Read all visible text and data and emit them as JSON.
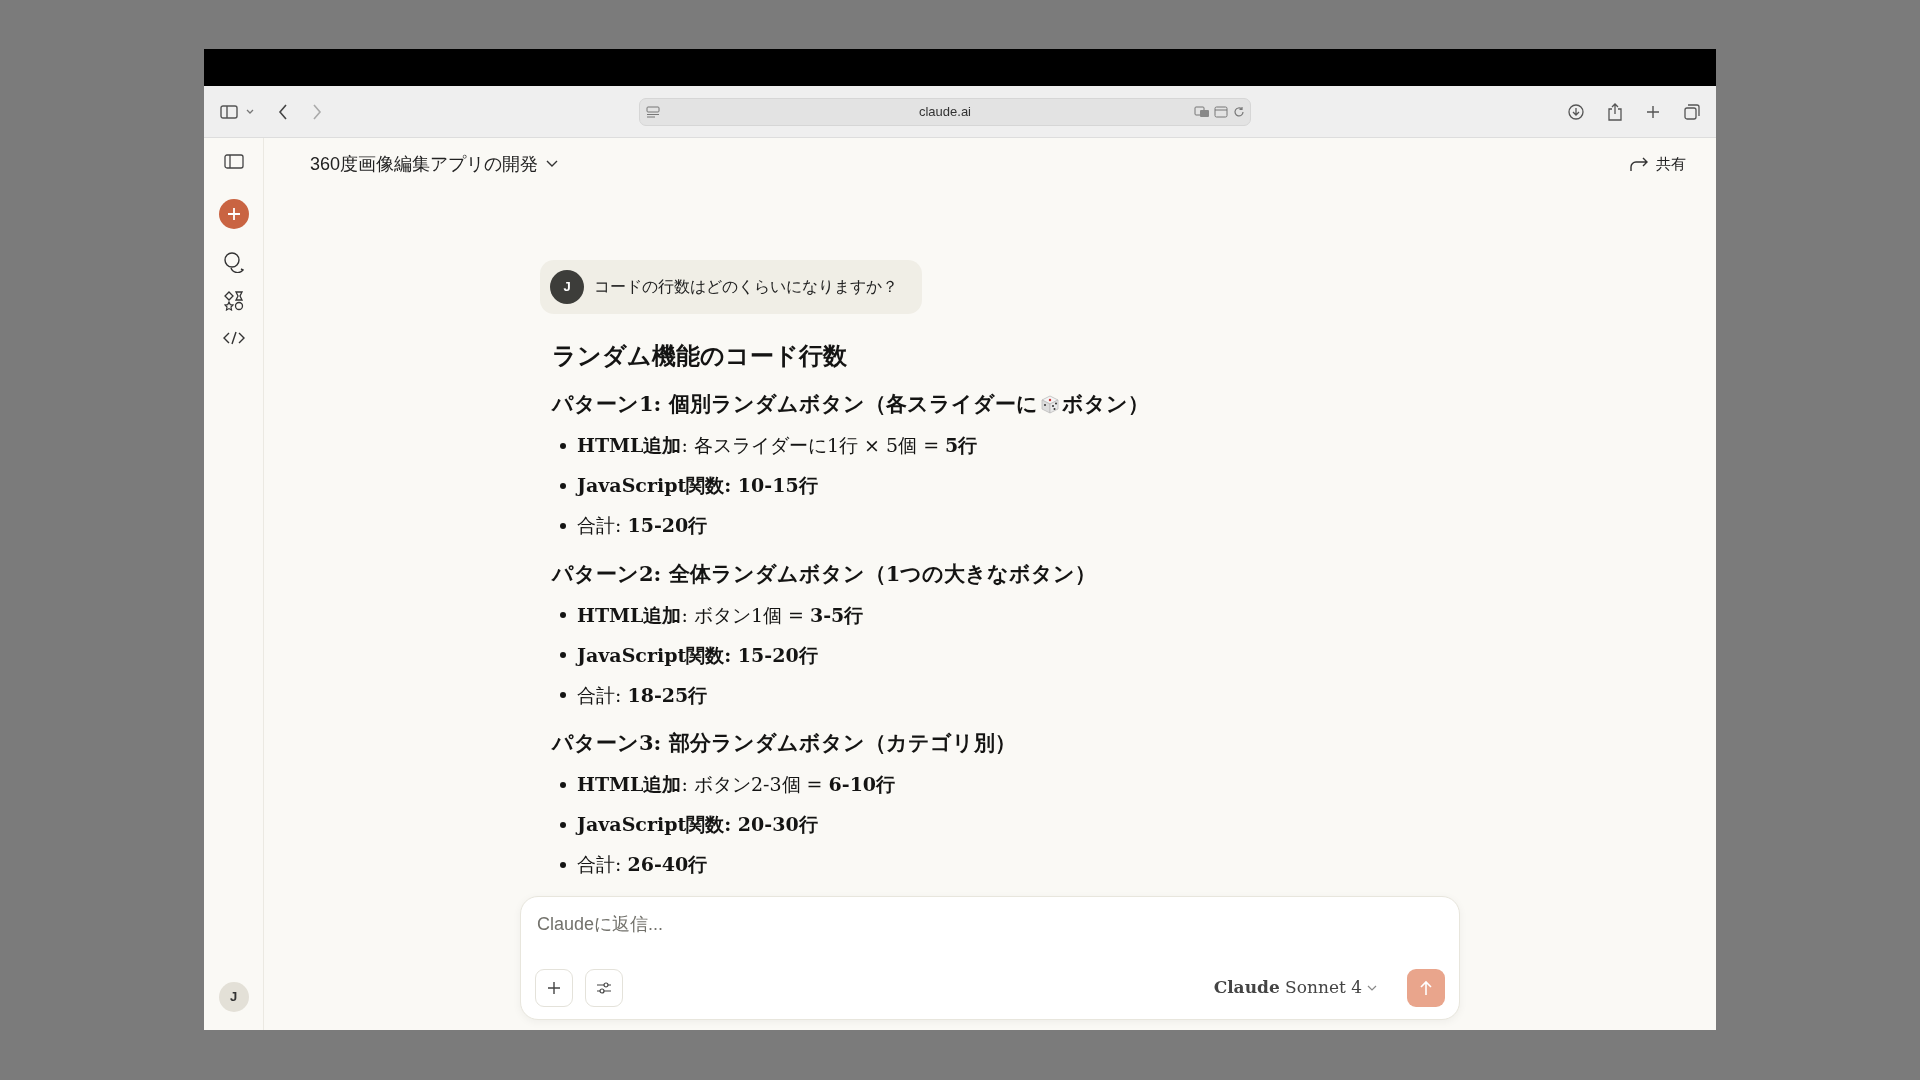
{
  "browser": {
    "address": "claude.ai"
  },
  "header": {
    "title": "360度画像編集アプリの開発",
    "share": "共有"
  },
  "sidebar": {
    "avatar": "J"
  },
  "user_message": {
    "avatar": "J",
    "text": "コードの行数はどのくらいになりますか？"
  },
  "response": {
    "title": "ランダム機能のコード行数",
    "sections": [
      {
        "heading_parts": [
          "パターン**1:** 個別ランダムボタン（各スライダーに",
          "ボタン）"
        ],
        "items": [
          "**HTML追加**: 各スライダーに1行 × 5個 = **5行**",
          "**JavaScript関数: 10-15行**",
          "合計: **15-20行**"
        ]
      },
      {
        "heading_parts": [
          "パターン**2:** 全体ランダムボタン（**1**つの大きなボタン）"
        ],
        "items": [
          "**HTML追加**: ボタン1個 = **3-5行**",
          "**JavaScript関数: 15-20行**",
          "合計: **18-25行**"
        ]
      },
      {
        "heading_parts": [
          "パターン**3:** 部分ランダムボタン（カテゴリ別）"
        ],
        "items": [
          "**HTML追加**: ボタン2-3個 = **6-10行**",
          "**JavaScript関数: 20-30行**",
          "合計: **26-40行**"
        ]
      }
    ]
  },
  "composer": {
    "placeholder": "Claudeに返信...",
    "model": "**Claude** Sonnet 4"
  }
}
